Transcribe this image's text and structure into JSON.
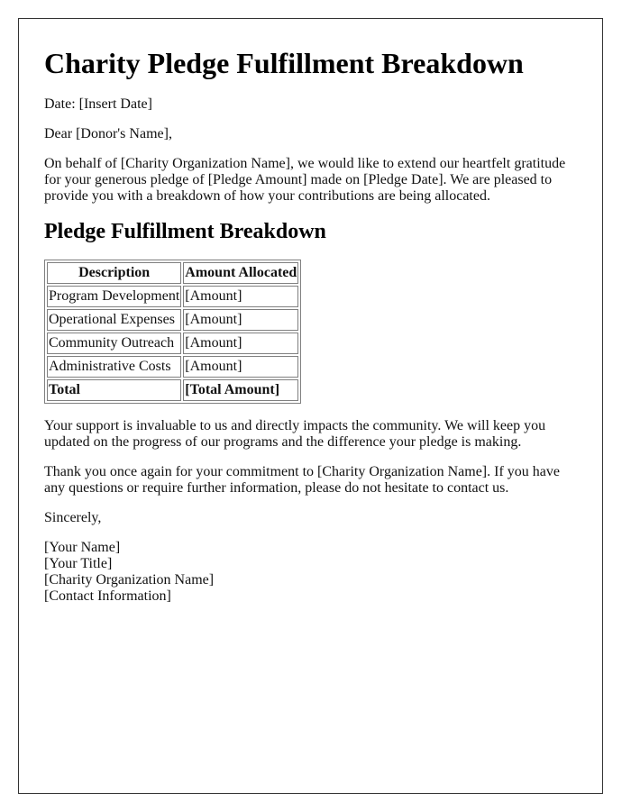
{
  "title": "Charity Pledge Fulfillment Breakdown",
  "date_line": "Date: [Insert Date]",
  "salutation": "Dear [Donor's Name],",
  "intro_paragraph": "On behalf of [Charity Organization Name], we would like to extend our heartfelt gratitude for your generous pledge of [Pledge Amount] made on [Pledge Date]. We are pleased to provide you with a breakdown of how your contributions are being allocated.",
  "section_heading": "Pledge Fulfillment Breakdown",
  "table": {
    "headers": [
      "Description",
      "Amount Allocated"
    ],
    "rows": [
      [
        "Program Development",
        "[Amount]"
      ],
      [
        "Operational Expenses",
        "[Amount]"
      ],
      [
        "Community Outreach",
        "[Amount]"
      ],
      [
        "Administrative Costs",
        "[Amount]"
      ]
    ],
    "total_row": [
      "Total",
      "[Total Amount]"
    ]
  },
  "support_paragraph": "Your support is invaluable to us and directly impacts the community. We will keep you updated on the progress of our programs and the difference your pledge is making.",
  "thanks_paragraph": "Thank you once again for your commitment to [Charity Organization Name]. If you have any questions or require further information, please do not hesitate to contact us.",
  "closing": "Sincerely,",
  "signature": {
    "name": "[Your Name]",
    "title": "[Your Title]",
    "organization": "[Charity Organization Name]",
    "contact": "[Contact Information]"
  }
}
